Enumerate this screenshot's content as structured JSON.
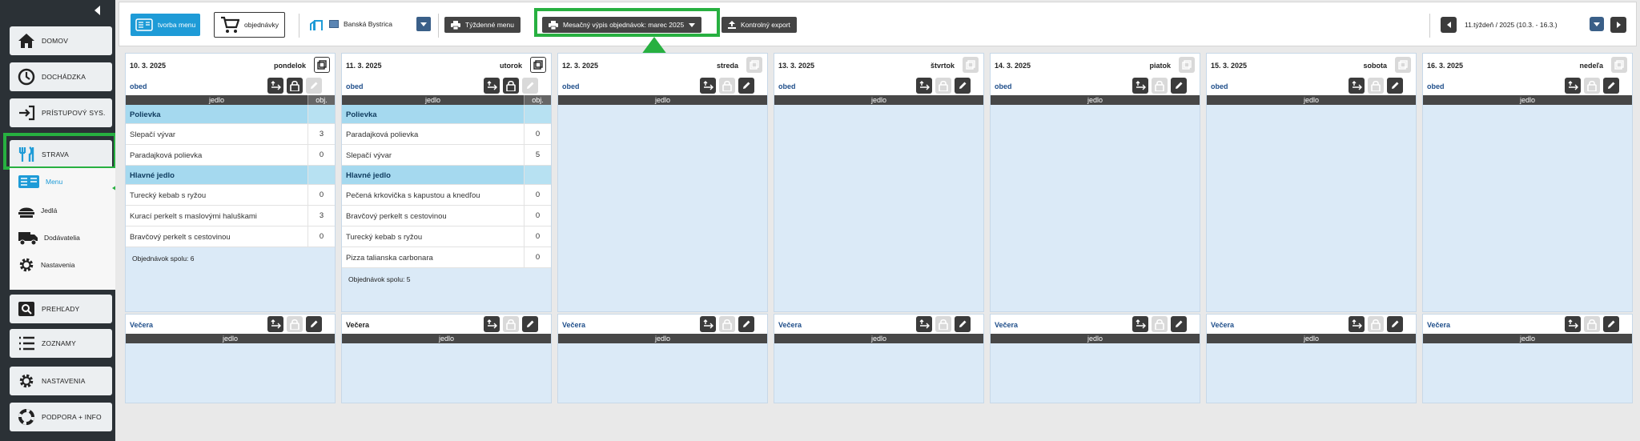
{
  "sidebar": {
    "items": [
      {
        "label": "DOMOV",
        "icon": "home-icon"
      },
      {
        "label": "DOCHÁDZKA",
        "icon": "clock-icon"
      },
      {
        "label": "PRÍSTUPOVÝ SYS.",
        "icon": "login-arrow-icon"
      },
      {
        "label": "STRAVA",
        "icon": "cutlery-icon"
      },
      {
        "label": "PREHĽADY",
        "icon": "search-icon"
      },
      {
        "label": "ZOZNAMY",
        "icon": "list-icon"
      },
      {
        "label": "NASTAVENIA",
        "icon": "gear-icon"
      },
      {
        "label": "PODPORA + INFO",
        "icon": "lifebuoy-icon"
      }
    ],
    "sub_items": [
      {
        "label": "Menu",
        "icon": "menu-book-icon"
      },
      {
        "label": "Jedlá",
        "icon": "food-icon"
      },
      {
        "label": "Dodávatelia",
        "icon": "truck-icon"
      },
      {
        "label": "Nastavenia",
        "icon": "gear-icon"
      }
    ]
  },
  "toolbar": {
    "create_menu": "tvorba menu",
    "orders": "objednávky",
    "location": "Banská Bystrica",
    "weekly_menu": "Týždenné menu",
    "monthly_orders": "Mesačný výpis objednávok: marec 2025",
    "control_export": "Kontrolný export",
    "week": "11.týždeň / 2025 (10.3. - 16.3.)"
  },
  "table": {
    "col_food": "jedlo",
    "col_orders": "obj."
  },
  "section_second": "Večera",
  "total_label": "Objednávok spolu:",
  "days": [
    {
      "date": "10. 3. 2025",
      "name": "pondelok",
      "meal": "obed",
      "rows": [
        {
          "cat": true,
          "name": "Polievka"
        },
        {
          "name": "Slepačí vývar",
          "count": "3"
        },
        {
          "name": "Paradajková polievka",
          "count": "0"
        },
        {
          "cat": true,
          "name": "Hlavné jedlo"
        },
        {
          "name": "Turecký kebab s ryžou",
          "count": "0"
        },
        {
          "name": "Kurací perkelt s maslovými haluškami",
          "count": "3"
        },
        {
          "name": "Bravčový perkelt s cestovinou",
          "count": "0"
        }
      ],
      "total": "6"
    },
    {
      "date": "11. 3. 2025",
      "name": "utorok",
      "meal": "obed",
      "rows": [
        {
          "cat": true,
          "name": "Polievka"
        },
        {
          "name": "Paradajková polievka",
          "count": "0"
        },
        {
          "name": "Slepačí vývar",
          "count": "5"
        },
        {
          "cat": true,
          "name": "Hlavné jedlo"
        },
        {
          "name": "Pečená krkovička s kapustou a knedľou",
          "count": "0"
        },
        {
          "name": "Bravčový perkelt s cestovinou",
          "count": "0"
        },
        {
          "name": "Turecký kebab s ryžou",
          "count": "0"
        },
        {
          "name": "Pizza talianska carbonara",
          "count": "0"
        }
      ],
      "total": "5"
    },
    {
      "date": "12. 3. 2025",
      "name": "streda",
      "meal": "obed",
      "rows": []
    },
    {
      "date": "13. 3. 2025",
      "name": "štvrtok",
      "meal": "obed",
      "rows": []
    },
    {
      "date": "14. 3. 2025",
      "name": "piatok",
      "meal": "obed",
      "rows": []
    },
    {
      "date": "15. 3. 2025",
      "name": "sobota",
      "meal": "obed",
      "rows": []
    },
    {
      "date": "16. 3. 2025",
      "name": "nedeľa",
      "meal": "obed",
      "rows": []
    }
  ],
  "colors": {
    "accent": "#1e9bd7",
    "highlight": "#27b040",
    "category": "#a5d9ef",
    "dark": "#3b3b3b"
  }
}
